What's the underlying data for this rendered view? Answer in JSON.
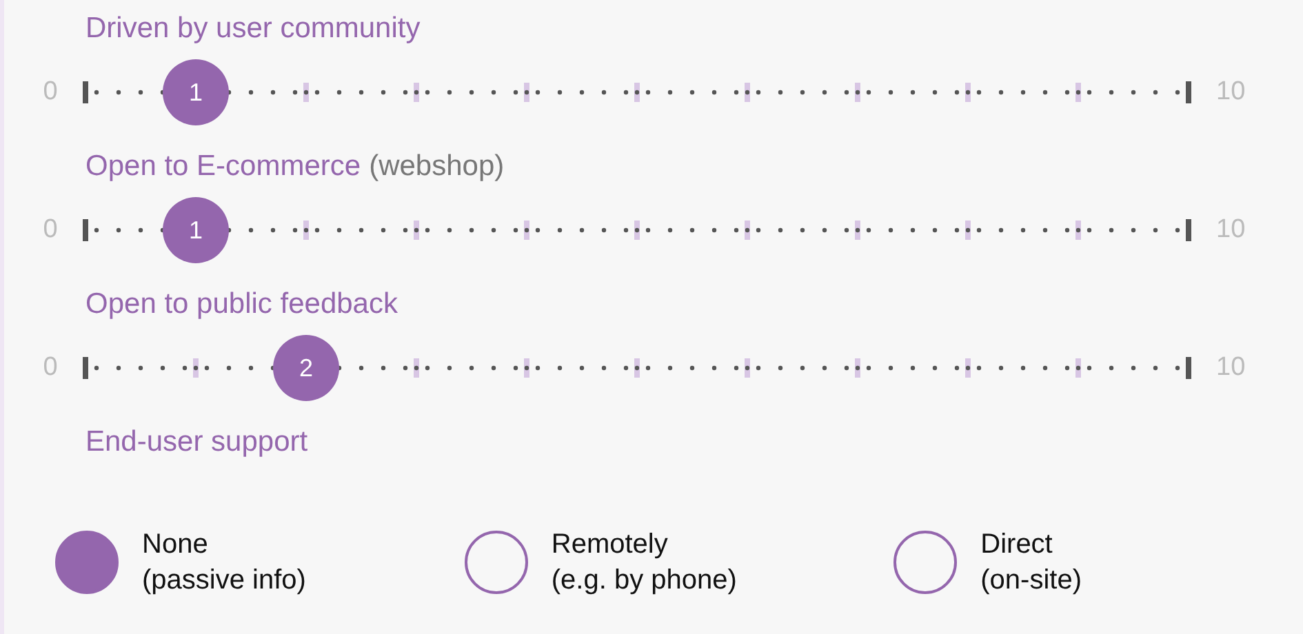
{
  "sliders": [
    {
      "label": "Driven by user community",
      "min_label": "0",
      "max_label": "10",
      "value_label": "1",
      "level": 0.1
    },
    {
      "label": "Open to E-commerce",
      "note": "(webshop)",
      "min_label": "0",
      "max_label": "10",
      "value_label": "1",
      "level": 0.1
    },
    {
      "label": "Open to public feedback",
      "min_label": "0",
      "max_label": "10",
      "value_label": "2",
      "level": 0.2
    }
  ],
  "support": {
    "label": "End-user support",
    "options": [
      {
        "line1": "None",
        "line2": "(passive info)",
        "selected": true
      },
      {
        "line1": "Remotely",
        "line2": "(e.g. by phone)",
        "selected": false
      },
      {
        "line1": "Direct",
        "line2": "(on-site)",
        "selected": false
      }
    ]
  }
}
